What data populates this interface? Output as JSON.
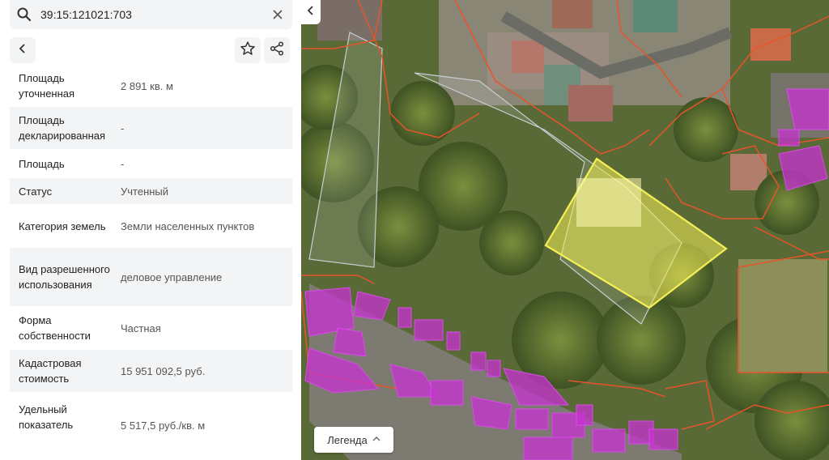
{
  "search": {
    "value": "39:15:121021:703"
  },
  "properties": [
    {
      "label": "Площадь уточненная",
      "value": "2 891 кв. м"
    },
    {
      "label": "Площадь декларированная",
      "value": "-"
    },
    {
      "label": "Площадь",
      "value": "-"
    },
    {
      "label": "Статус",
      "value": "Учтенный"
    },
    {
      "label": "Категория земель",
      "value": "Земли населенных пунктов"
    },
    {
      "label": "Вид разрешенного использования",
      "value": "деловое управление"
    },
    {
      "label": "Форма собственности",
      "value": "Частная"
    },
    {
      "label": "Кадастровая стоимость",
      "value": "15 951 092,5 руб."
    },
    {
      "label": "Удельный показатель",
      "value": "5 517,5 руб./кв. м"
    }
  ],
  "legend": {
    "label": "Легенда"
  },
  "colors": {
    "selected_parcel": "#f5ef55",
    "parcel_border": "#e8542a",
    "building_fill": "#c832d2",
    "panel_alt_bg": "#f3f4f6"
  },
  "icons": [
    "search-icon",
    "close-icon",
    "chevron-left-icon",
    "star-icon",
    "share-icon",
    "chevron-up-icon"
  ]
}
